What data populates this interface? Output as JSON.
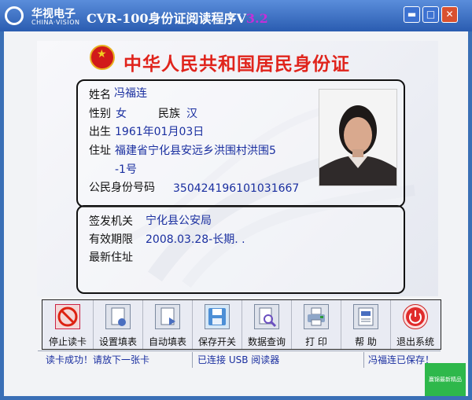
{
  "window": {
    "logo_cn": "华视电子",
    "logo_en": "CHINA·VISION",
    "title_main": "CVR-100身份证阅读程序V",
    "title_version": "3.2",
    "min_glyph": "▬",
    "max_glyph": "□",
    "close_glyph": "✕"
  },
  "card": {
    "title": "中华人民共和国居民身份证",
    "name_label": "姓名",
    "name_value": "冯福连",
    "sex_label": "性别",
    "sex_value": "女",
    "ethnicity_label": "民族",
    "ethnicity_value": "汉",
    "birth_label": "出生",
    "birth_value": "1961年01月03日",
    "address_label": "住址",
    "address_line1": "福建省宁化县安远乡洪围村洪围5",
    "address_line2": "-1号",
    "id_label": "公民身份号码",
    "id_value": "350424196101031667",
    "authority_label": "签发机关",
    "authority_value": "宁化县公安局",
    "validity_label": "有效期限",
    "validity_value": "2008.03.28-长期.  .",
    "latest_address_label": "最新住址",
    "latest_address_value": ""
  },
  "toolbar": {
    "buttons": [
      {
        "label": "停止读卡",
        "icon": "stop-read-icon"
      },
      {
        "label": "设置填表",
        "icon": "form-settings-icon"
      },
      {
        "label": "自动填表",
        "icon": "auto-fill-icon"
      },
      {
        "label": "保存开关",
        "icon": "save-floppy-icon"
      },
      {
        "label": "数据查询",
        "icon": "search-magnifier-icon"
      },
      {
        "label": "打 印",
        "icon": "printer-icon"
      },
      {
        "label": "帮 助",
        "icon": "help-document-icon"
      },
      {
        "label": "退出系统",
        "icon": "exit-power-icon"
      }
    ]
  },
  "status": {
    "read_status": "读卡成功！请放下一张卡",
    "device_status": "已连接 USB 阅读器",
    "save_status": "冯福连已保存！"
  },
  "badge": {
    "text": "赢锦最新精品"
  },
  "colors": {
    "title_accent": "#c42fd8",
    "card_title": "#e0241c",
    "value_text": "#1a2fa0",
    "titlebar": "#2a5cb0"
  }
}
